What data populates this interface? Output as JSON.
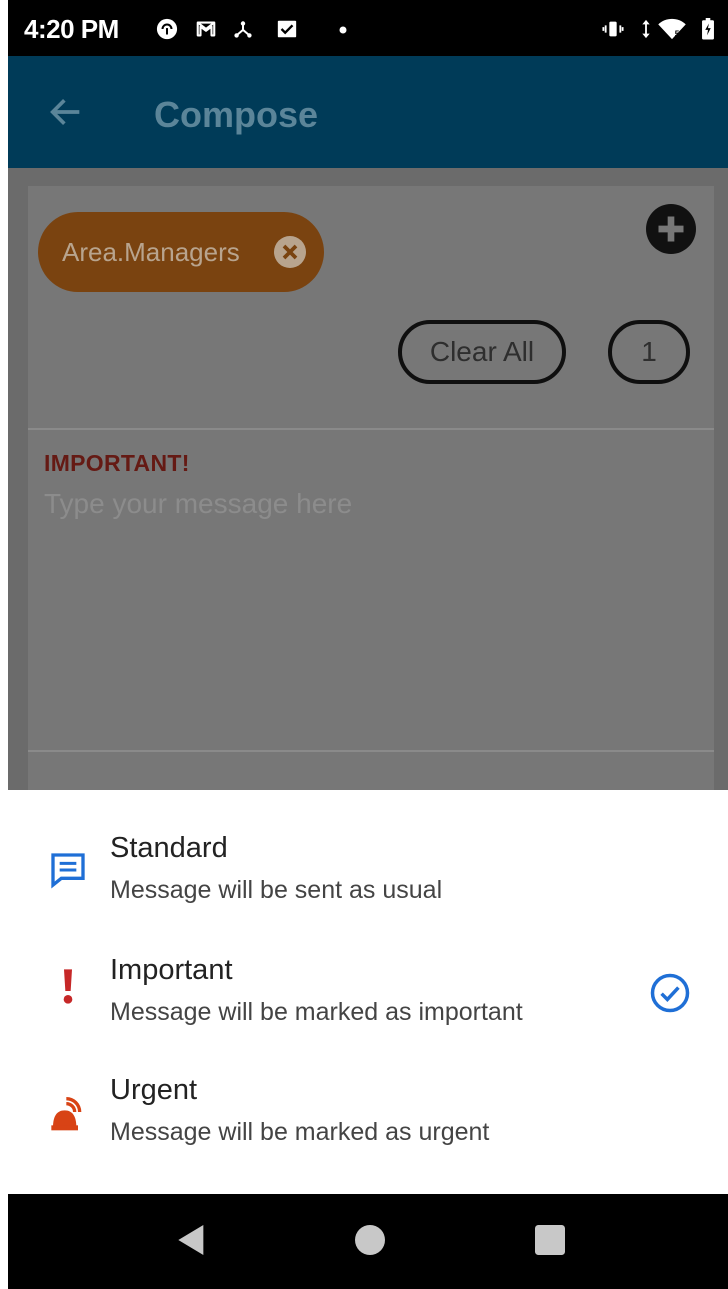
{
  "status_bar": {
    "time": "4:20 PM",
    "icons": [
      "pocket-casts-icon",
      "gmail-icon",
      "network-icon",
      "tasks-icon",
      "dot-icon",
      "vibrate-icon",
      "data-arrows-icon",
      "wifi-icon",
      "battery-icon"
    ]
  },
  "app_bar": {
    "title": "Compose",
    "back_icon": "arrow-back-icon"
  },
  "recipients": {
    "chip_label": "Area.Managers",
    "clear_all_label": "Clear All",
    "count": "1"
  },
  "message": {
    "priority_label": "IMPORTANT!",
    "placeholder": "Type your message here"
  },
  "priority_sheet": {
    "options": [
      {
        "icon": "message-icon",
        "title": "Standard",
        "subtitle": "Message will be sent as usual",
        "selected": false,
        "color": "#1f6fd6"
      },
      {
        "icon": "exclamation-icon",
        "title": "Important",
        "subtitle": "Message will be marked as important",
        "selected": true,
        "color": "#c62828"
      },
      {
        "icon": "alarm-icon",
        "title": "Urgent",
        "subtitle": "Message will be marked as urgent",
        "selected": false,
        "color": "#d84315"
      }
    ],
    "check_color": "#1f6fd6"
  },
  "nav_bar": {
    "buttons": [
      "back-triangle-icon",
      "home-circle-icon",
      "recents-square-icon"
    ]
  },
  "colors": {
    "app_bar": "#003b58",
    "chip": "#7a4310",
    "scrim": "#6b6b6b"
  }
}
